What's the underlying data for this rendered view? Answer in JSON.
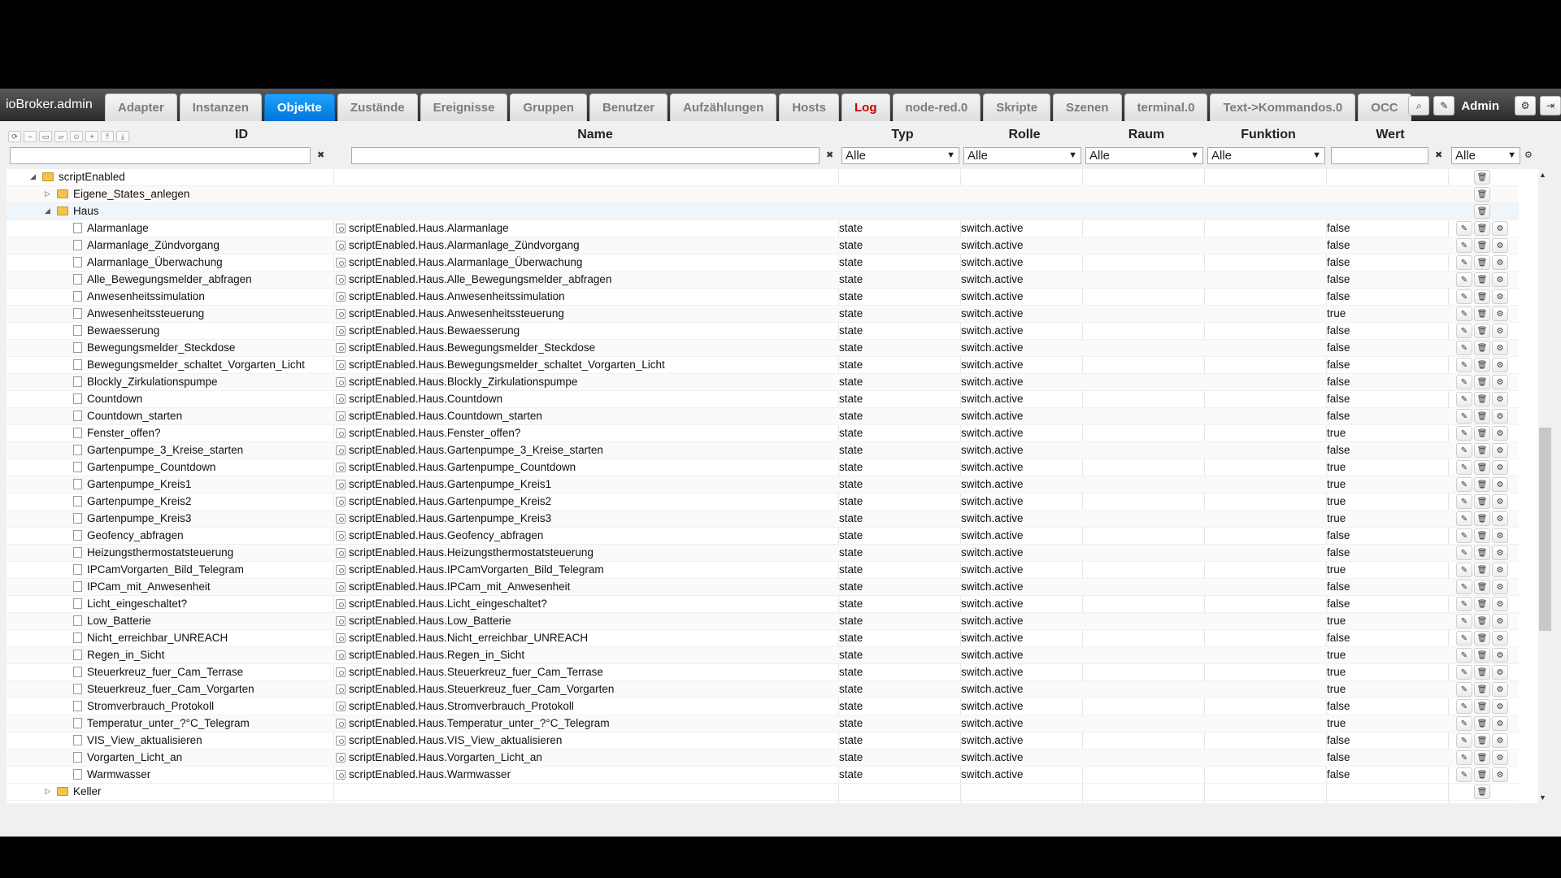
{
  "app": {
    "brand": "ioBroker.admin",
    "user": "Admin"
  },
  "tabs": [
    {
      "label": "Adapter",
      "state": ""
    },
    {
      "label": "Instanzen",
      "state": ""
    },
    {
      "label": "Objekte",
      "state": "active"
    },
    {
      "label": "Zustände",
      "state": ""
    },
    {
      "label": "Ereignisse",
      "state": ""
    },
    {
      "label": "Gruppen",
      "state": ""
    },
    {
      "label": "Benutzer",
      "state": ""
    },
    {
      "label": "Aufzählungen",
      "state": ""
    },
    {
      "label": "Hosts",
      "state": ""
    },
    {
      "label": "Log",
      "state": "red"
    },
    {
      "label": "node-red.0",
      "state": ""
    },
    {
      "label": "Skripte",
      "state": ""
    },
    {
      "label": "Szenen",
      "state": ""
    },
    {
      "label": "terminal.0",
      "state": ""
    },
    {
      "label": "Text->Kommandos.0",
      "state": ""
    },
    {
      "label": "OCC",
      "state": ""
    }
  ],
  "columns": {
    "id": "ID",
    "name": "Name",
    "typ": "Typ",
    "rolle": "Rolle",
    "raum": "Raum",
    "funktion": "Funktion",
    "wert": "Wert"
  },
  "filters": {
    "typ": "Alle",
    "rolle": "Alle",
    "raum": "Alle",
    "funktion": "Alle",
    "wert_type": "Alle"
  },
  "tree": {
    "root": "scriptEnabled",
    "folders": {
      "eigene": "Eigene_States_anlegen",
      "haus": "Haus",
      "keller": "Keller"
    },
    "rows": [
      {
        "id": "Alarmanlage",
        "name": "scriptEnabled.Haus.Alarmanlage",
        "typ": "state",
        "rolle": "switch.active",
        "wert": "false"
      },
      {
        "id": "Alarmanlage_Zündvorgang",
        "name": "scriptEnabled.Haus.Alarmanlage_Zündvorgang",
        "typ": "state",
        "rolle": "switch.active",
        "wert": "false"
      },
      {
        "id": "Alarmanlage_Überwachung",
        "name": "scriptEnabled.Haus.Alarmanlage_Überwachung",
        "typ": "state",
        "rolle": "switch.active",
        "wert": "false"
      },
      {
        "id": "Alle_Bewegungsmelder_abfragen",
        "name": "scriptEnabled.Haus.Alle_Bewegungsmelder_abfragen",
        "typ": "state",
        "rolle": "switch.active",
        "wert": "false"
      },
      {
        "id": "Anwesenheitssimulation",
        "name": "scriptEnabled.Haus.Anwesenheitssimulation",
        "typ": "state",
        "rolle": "switch.active",
        "wert": "false"
      },
      {
        "id": "Anwesenheitssteuerung",
        "name": "scriptEnabled.Haus.Anwesenheitssteuerung",
        "typ": "state",
        "rolle": "switch.active",
        "wert": "true"
      },
      {
        "id": "Bewaesserung",
        "name": "scriptEnabled.Haus.Bewaesserung",
        "typ": "state",
        "rolle": "switch.active",
        "wert": "false"
      },
      {
        "id": "Bewegungsmelder_Steckdose",
        "name": "scriptEnabled.Haus.Bewegungsmelder_Steckdose",
        "typ": "state",
        "rolle": "switch.active",
        "wert": "false"
      },
      {
        "id": "Bewegungsmelder_schaltet_Vorgarten_Licht",
        "name": "scriptEnabled.Haus.Bewegungsmelder_schaltet_Vorgarten_Licht",
        "typ": "state",
        "rolle": "switch.active",
        "wert": "false"
      },
      {
        "id": "Blockly_Zirkulationspumpe",
        "name": "scriptEnabled.Haus.Blockly_Zirkulationspumpe",
        "typ": "state",
        "rolle": "switch.active",
        "wert": "false"
      },
      {
        "id": "Countdown",
        "name": "scriptEnabled.Haus.Countdown",
        "typ": "state",
        "rolle": "switch.active",
        "wert": "false"
      },
      {
        "id": "Countdown_starten",
        "name": "scriptEnabled.Haus.Countdown_starten",
        "typ": "state",
        "rolle": "switch.active",
        "wert": "false"
      },
      {
        "id": "Fenster_offen?",
        "name": "scriptEnabled.Haus.Fenster_offen?",
        "typ": "state",
        "rolle": "switch.active",
        "wert": "true"
      },
      {
        "id": "Gartenpumpe_3_Kreise_starten",
        "name": "scriptEnabled.Haus.Gartenpumpe_3_Kreise_starten",
        "typ": "state",
        "rolle": "switch.active",
        "wert": "false"
      },
      {
        "id": "Gartenpumpe_Countdown",
        "name": "scriptEnabled.Haus.Gartenpumpe_Countdown",
        "typ": "state",
        "rolle": "switch.active",
        "wert": "true"
      },
      {
        "id": "Gartenpumpe_Kreis1",
        "name": "scriptEnabled.Haus.Gartenpumpe_Kreis1",
        "typ": "state",
        "rolle": "switch.active",
        "wert": "true"
      },
      {
        "id": "Gartenpumpe_Kreis2",
        "name": "scriptEnabled.Haus.Gartenpumpe_Kreis2",
        "typ": "state",
        "rolle": "switch.active",
        "wert": "true"
      },
      {
        "id": "Gartenpumpe_Kreis3",
        "name": "scriptEnabled.Haus.Gartenpumpe_Kreis3",
        "typ": "state",
        "rolle": "switch.active",
        "wert": "true"
      },
      {
        "id": "Geofency_abfragen",
        "name": "scriptEnabled.Haus.Geofency_abfragen",
        "typ": "state",
        "rolle": "switch.active",
        "wert": "false"
      },
      {
        "id": "Heizungsthermostatsteuerung",
        "name": "scriptEnabled.Haus.Heizungsthermostatsteuerung",
        "typ": "state",
        "rolle": "switch.active",
        "wert": "false"
      },
      {
        "id": "IPCamVorgarten_Bild_Telegram",
        "name": "scriptEnabled.Haus.IPCamVorgarten_Bild_Telegram",
        "typ": "state",
        "rolle": "switch.active",
        "wert": "true"
      },
      {
        "id": "IPCam_mit_Anwesenheit",
        "name": "scriptEnabled.Haus.IPCam_mit_Anwesenheit",
        "typ": "state",
        "rolle": "switch.active",
        "wert": "false"
      },
      {
        "id": "Licht_eingeschaltet?",
        "name": "scriptEnabled.Haus.Licht_eingeschaltet?",
        "typ": "state",
        "rolle": "switch.active",
        "wert": "false"
      },
      {
        "id": "Low_Batterie",
        "name": "scriptEnabled.Haus.Low_Batterie",
        "typ": "state",
        "rolle": "switch.active",
        "wert": "true"
      },
      {
        "id": "Nicht_erreichbar_UNREACH",
        "name": "scriptEnabled.Haus.Nicht_erreichbar_UNREACH",
        "typ": "state",
        "rolle": "switch.active",
        "wert": "false"
      },
      {
        "id": "Regen_in_Sicht",
        "name": "scriptEnabled.Haus.Regen_in_Sicht",
        "typ": "state",
        "rolle": "switch.active",
        "wert": "true"
      },
      {
        "id": "Steuerkreuz_fuer_Cam_Terrase",
        "name": "scriptEnabled.Haus.Steuerkreuz_fuer_Cam_Terrase",
        "typ": "state",
        "rolle": "switch.active",
        "wert": "true"
      },
      {
        "id": "Steuerkreuz_fuer_Cam_Vorgarten",
        "name": "scriptEnabled.Haus.Steuerkreuz_fuer_Cam_Vorgarten",
        "typ": "state",
        "rolle": "switch.active",
        "wert": "true"
      },
      {
        "id": "Stromverbrauch_Protokoll",
        "name": "scriptEnabled.Haus.Stromverbrauch_Protokoll",
        "typ": "state",
        "rolle": "switch.active",
        "wert": "false"
      },
      {
        "id": "Temperatur_unter_?°C_Telegram",
        "name": "scriptEnabled.Haus.Temperatur_unter_?°C_Telegram",
        "typ": "state",
        "rolle": "switch.active",
        "wert": "true"
      },
      {
        "id": "VIS_View_aktualisieren",
        "name": "scriptEnabled.Haus.VIS_View_aktualisieren",
        "typ": "state",
        "rolle": "switch.active",
        "wert": "false"
      },
      {
        "id": "Vorgarten_Licht_an",
        "name": "scriptEnabled.Haus.Vorgarten_Licht_an",
        "typ": "state",
        "rolle": "switch.active",
        "wert": "false"
      },
      {
        "id": "Warmwasser",
        "name": "scriptEnabled.Haus.Warmwasser",
        "typ": "state",
        "rolle": "switch.active",
        "wert": "false"
      }
    ]
  },
  "icons": {
    "close": "✖",
    "search": "⌕",
    "edit": "✎",
    "settings": "⚙",
    "logout": "⇥",
    "delete": "🗑",
    "expanded": "◢",
    "collapsed": "▷",
    "scroll_up": "▲",
    "scroll_down": "▼",
    "select_arrow": "▼"
  },
  "colors": {
    "active_tab": "#0074d9",
    "log_tab": "#cc0000",
    "folder": "#f3c24f"
  }
}
